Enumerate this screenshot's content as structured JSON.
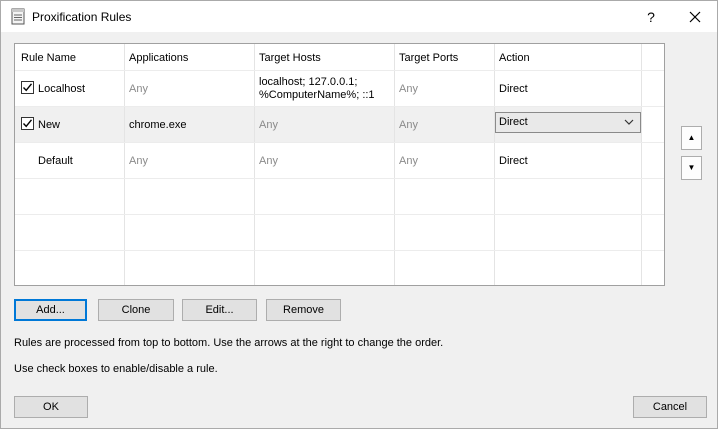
{
  "window": {
    "title": "Proxification Rules",
    "help": "?"
  },
  "table": {
    "headers": [
      "Rule Name",
      "Applications",
      "Target Hosts",
      "Target Ports",
      "Action"
    ],
    "rows": [
      {
        "name": "Localhost",
        "checked": true,
        "applications": "Any",
        "hosts_line1": "localhost; 127.0.0.1;",
        "hosts_line2": "%ComputerName%; ::1",
        "ports": "Any",
        "action": "Direct"
      },
      {
        "name": "New",
        "checked": true,
        "applications": "chrome.exe",
        "hosts": "Any",
        "ports": "Any",
        "action": "Direct"
      },
      {
        "name": "Default",
        "checked": false,
        "applications": "Any",
        "hosts": "Any",
        "ports": "Any",
        "action": "Direct"
      }
    ]
  },
  "buttons": {
    "add": "Add...",
    "clone": "Clone",
    "edit": "Edit...",
    "remove": "Remove",
    "ok": "OK",
    "cancel": "Cancel",
    "up": "▲",
    "down": "▼"
  },
  "info": {
    "line1": "Rules are processed from top to bottom. Use the arrows at the right to change the order.",
    "line2": "Use check boxes to enable/disable a rule."
  },
  "colors": {
    "default_button_border": "#0078d7",
    "selected_row": "#f0f0f0"
  }
}
